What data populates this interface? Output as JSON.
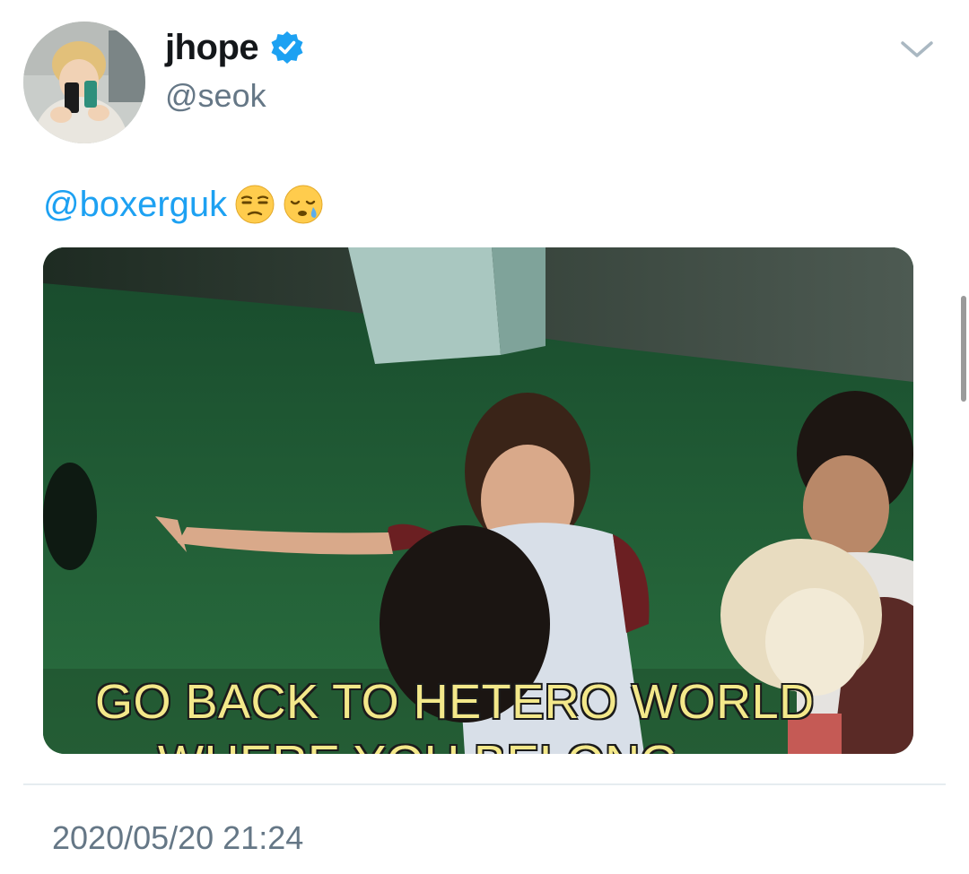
{
  "tweet": {
    "display_name": "jhope",
    "handle": "@seok",
    "verified": true,
    "mention": "@boxerguk",
    "emojis": [
      "unamused-face-emoji",
      "sleepy-face-emoji"
    ],
    "media": {
      "caption_line1": "GO BACK TO HETERO WORLD",
      "caption_line2": "WHERE YOU BELONG"
    },
    "timestamp": "2020/05/20 21:24"
  },
  "icons": {
    "verified": "verified-badge-icon",
    "menu": "chevron-down-icon"
  },
  "colors": {
    "accent": "#1da1f2",
    "secondary_text": "#657786",
    "primary_text": "#14171a",
    "divider": "#e6ecf0",
    "caption": "#f3e88a"
  }
}
